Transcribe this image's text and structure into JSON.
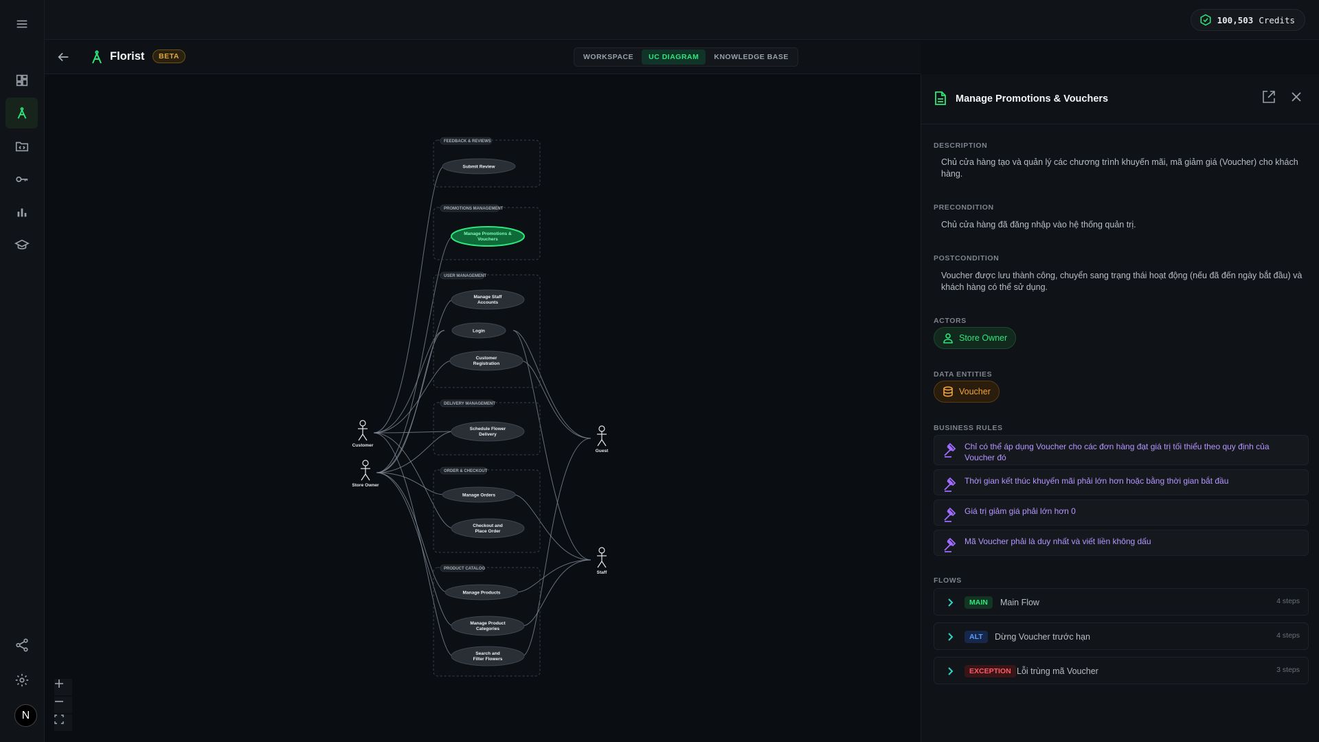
{
  "credits": {
    "amount": "100,503",
    "label": "Credits"
  },
  "project": {
    "name": "Florist",
    "badge": "BETA"
  },
  "tabs": [
    "WORKSPACE",
    "UC DIAGRAM",
    "KNOWLEDGE BASE"
  ],
  "active_tab": "UC DIAGRAM",
  "diagram": {
    "groups": [
      {
        "title": "FEEDBACK & REVIEWS",
        "use_cases": [
          "Submit Review"
        ]
      },
      {
        "title": "PROMOTIONS MANAGEMENT",
        "use_cases": [
          "Manage Promotions & Vouchers"
        ]
      },
      {
        "title": "USER MANAGEMENT",
        "use_cases": [
          "Manage Staff Accounts",
          "Login",
          "Customer Registration"
        ]
      },
      {
        "title": "DELIVERY MANAGEMENT",
        "use_cases": [
          "Schedule Flower Delivery"
        ]
      },
      {
        "title": "ORDER & CHECKOUT",
        "use_cases": [
          "Manage Orders",
          "Checkout and Place Order"
        ]
      },
      {
        "title": "PRODUCT CATALOG",
        "use_cases": [
          "Manage Products",
          "Manage Product Categories",
          "Search and Filter Flowers"
        ]
      }
    ],
    "actors": [
      "Customer",
      "Store Owner",
      "Guest",
      "Staff"
    ],
    "selected": "Manage Promotions & Vouchers"
  },
  "panel": {
    "title": "Manage Promotions & Vouchers",
    "description_label": "DESCRIPTION",
    "description": "Chủ cửa hàng tạo và quản lý các chương trình khuyến mãi, mã giảm giá (Voucher) cho khách hàng.",
    "precondition_label": "PRECONDITION",
    "precondition": "Chủ cửa hàng đã đăng nhập vào hệ thống quản trị.",
    "postcondition_label": "POSTCONDITION",
    "postcondition": "Voucher được lưu thành công, chuyển sang trạng thái hoạt động (nếu đã đến ngày bắt đầu) và khách hàng có thể sử dụng.",
    "actors_label": "ACTORS",
    "actors": [
      "Store Owner"
    ],
    "entities_label": "DATA ENTITIES",
    "entities": [
      "Voucher"
    ],
    "rules_label": "BUSINESS RULES",
    "rules": [
      "Chỉ có thể áp dụng Voucher cho các đơn hàng đạt giá trị tối thiểu theo quy định của Voucher đó",
      "Thời gian kết thúc khuyến mãi phải lớn hơn hoặc bằng thời gian bắt đầu",
      "Giá trị giảm giá phải lớn hơn 0",
      "Mã Voucher phải là duy nhất và viết liền không dấu"
    ],
    "flows_label": "FLOWS",
    "flows": [
      {
        "type": "MAIN",
        "name": "Main Flow",
        "steps": "4 steps"
      },
      {
        "type": "ALT",
        "name": "Dừng Voucher trước hạn",
        "steps": "4 steps"
      },
      {
        "type": "EXCEPTION",
        "name": "Lỗi trùng mã Voucher",
        "steps": "3 steps"
      }
    ]
  },
  "colors": {
    "accent": "#2ee67a",
    "warning": "#f2a43a",
    "rule": "#a06bff",
    "error": "#ff5a64"
  }
}
